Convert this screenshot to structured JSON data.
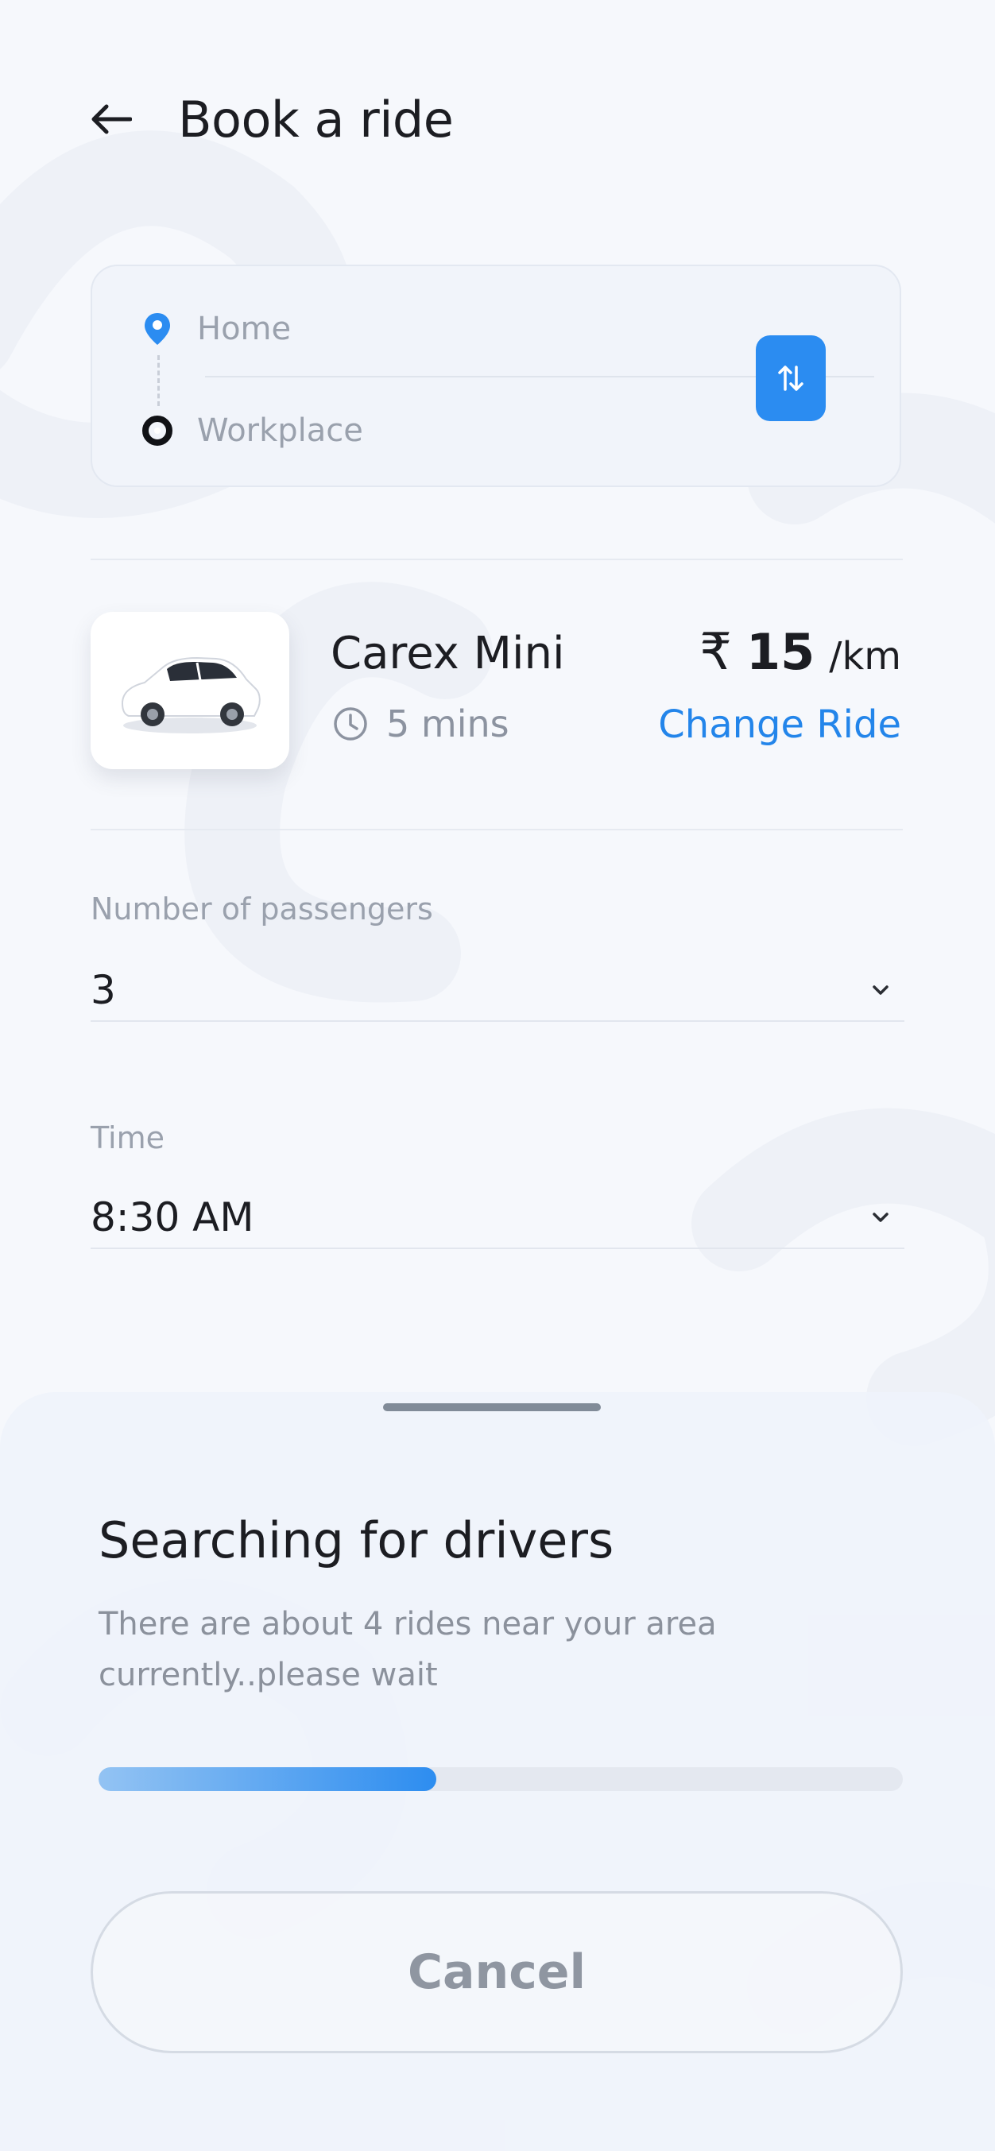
{
  "header": {
    "title": "Book a ride",
    "back_icon": "arrow-left-icon"
  },
  "route": {
    "from": "Home",
    "to": "Workplace",
    "from_icon": "location-pin-icon",
    "to_icon": "destination-circle-icon",
    "swap_icon": "swap-vertical-icon"
  },
  "ride": {
    "name": "Carex Mini",
    "eta": "5 mins",
    "eta_icon": "clock-icon",
    "currency": "₹",
    "price": "15",
    "unit": "/km",
    "change_label": "Change Ride",
    "image_icon": "car-icon"
  },
  "passengers": {
    "label": "Number of passengers",
    "value": "3"
  },
  "time": {
    "label": "Time",
    "value": "8:30 AM"
  },
  "sheet": {
    "title": "Searching for drivers",
    "subtitle_line1": "There are about 4 rides near your area",
    "subtitle_line2": "currently..please wait",
    "progress": 0.42,
    "cancel_label": "Cancel"
  },
  "colors": {
    "accent": "#2b8cf1",
    "background": "#f6f8fc",
    "text": "#1c1d22",
    "muted": "#9aa1ad"
  }
}
